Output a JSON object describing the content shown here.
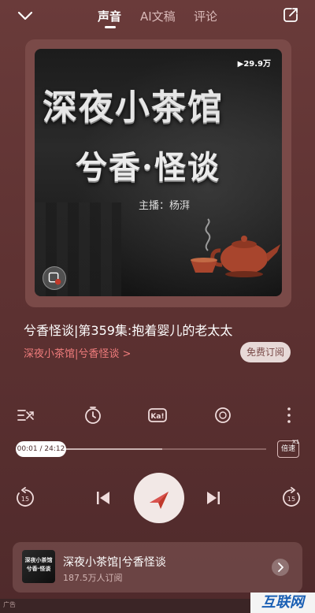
{
  "header": {
    "tabs": [
      {
        "label": "声音",
        "active": true
      },
      {
        "label": "AI文稿",
        "active": false
      },
      {
        "label": "评论",
        "active": false
      }
    ]
  },
  "cover": {
    "plays": "▶29.9万",
    "title_line1": "深夜小茶馆",
    "title_line2": "兮香·怪谈",
    "host": "主播：杨湃"
  },
  "episode": {
    "title": "兮香怪谈|第359集:抱着婴儿的老太太",
    "album_link": "深夜小茶馆|兮香怪谈 >",
    "subscribe_label": "免费订阅"
  },
  "progress": {
    "time_text": "00:01 / 24:12",
    "buffered_fraction": 0.57,
    "speed_label": "倍速",
    "speed_value": "X1"
  },
  "album_card": {
    "thumb_line1": "深夜小茶馆",
    "thumb_line2": "兮香·怪谈",
    "name": "深夜小茶馆|兮香怪谈",
    "subscribers": "187.5万人订阅"
  },
  "footer": {
    "ad_label": "广告",
    "watermark": "互联网"
  },
  "colors": {
    "accent": "#f07c7c",
    "background": "#5e3232"
  },
  "icons": [
    "chevron-down-icon",
    "share-icon",
    "shuffle-icon",
    "timer-icon",
    "ka-icon",
    "reward-icon",
    "more-icon",
    "rewind-15-icon",
    "previous-icon",
    "play-icon",
    "next-icon",
    "forward-15-icon",
    "chevron-right-icon"
  ]
}
